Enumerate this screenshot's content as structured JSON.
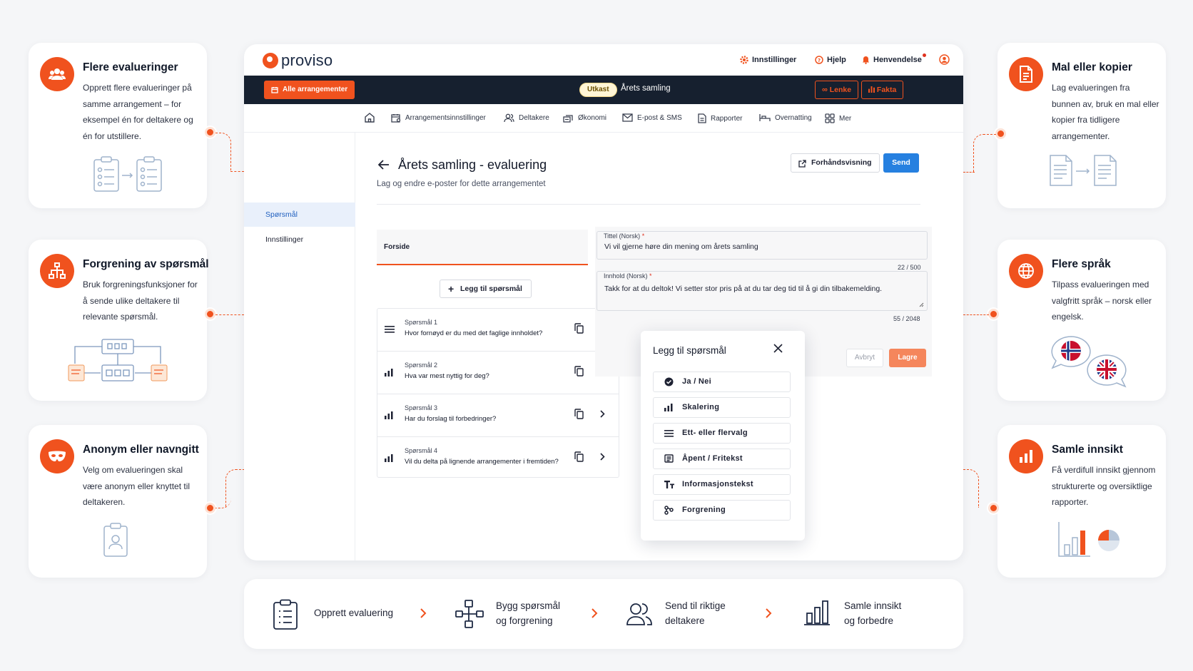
{
  "brand": {
    "name": "proviso",
    "accent": "#f0521e",
    "primary": "#2680e0",
    "dark": "#16202f"
  },
  "topnav": {
    "settings": "Innstillinger",
    "help": "Hjelp",
    "requests": "Henvendelse"
  },
  "darkbar": {
    "all_events": "Alle arrangementer",
    "status": "Utkast",
    "event_name": "Årets samling",
    "link": "Lenke",
    "facts": "Fakta"
  },
  "modules": [
    "Arrangementsinnstillinger",
    "Deltakere",
    "Økonomi",
    "E-post & SMS",
    "Rapporter",
    "Overnatting",
    "Mer"
  ],
  "sidebar": {
    "items": [
      {
        "label": "Spørsmål"
      },
      {
        "label": "Innstillinger"
      }
    ]
  },
  "page": {
    "title": "Årets samling - evaluering",
    "subtitle": "Lag og endre e-poster for dette arrangementet",
    "preview": "Forhåndsvisning",
    "send": "Send"
  },
  "tab": "Forside",
  "add_question": "Legg til spørsmål",
  "questions": [
    {
      "num": "Spørsmål 1",
      "text": "Hvor fornøyd er du med det faglige innholdet?",
      "icon": "list-lines-icon"
    },
    {
      "num": "Spørsmål 2",
      "text": "Hva var mest nyttig for deg?",
      "icon": "bar-chart-icon"
    },
    {
      "num": "Spørsmål 3",
      "text": "Har du forslag til forbedringer?",
      "icon": "bar-chart-icon"
    },
    {
      "num": "Spørsmål 4",
      "text": "Vil du delta på lignende arrangementer i fremtiden?",
      "icon": "bar-chart-icon"
    }
  ],
  "form": {
    "title_label": "Tittel (Norsk)",
    "title_value": "Vi vil gjerne høre din mening om årets samling",
    "title_count": "22 / 500",
    "content_label": "Innhold (Norsk)",
    "content_value": "Takk for at du deltok! Vi setter stor pris på at du tar deg tid til å gi din tilbakemelding.",
    "content_count": "55 / 2048",
    "required": "*",
    "cancel": "Avbryt",
    "save": "Lagre"
  },
  "popup": {
    "title": "Legg til spørsmål",
    "options": [
      {
        "label": "Ja / Nei",
        "icon": "check-circle-icon"
      },
      {
        "label": "Skalering",
        "icon": "bar-chart-icon"
      },
      {
        "label": "Ett- eller flervalg",
        "icon": "list-lines-icon"
      },
      {
        "label": "Åpent / Fritekst",
        "icon": "text-box-icon"
      },
      {
        "label": "Informasjonstekst",
        "icon": "text-format-icon"
      },
      {
        "label": "Forgrening",
        "icon": "branch-icon"
      }
    ]
  },
  "features_left": [
    {
      "title": "Flere evalueringer",
      "desc": "Opprett flere evalueringer på samme arrangement – for eksempel én for deltakere og én for utstillere."
    },
    {
      "title": "Forgrening av spørsmål",
      "desc": "Bruk forgreningsfunksjoner for å sende ulike deltakere til relevante spørsmål."
    },
    {
      "title": "Anonym eller navngitt",
      "desc": "Velg om evalueringen skal være anonym eller knyttet til deltakeren."
    }
  ],
  "features_right": [
    {
      "title": "Mal eller kopier",
      "desc": "Lag evalueringen fra bunnen av, bruk en mal eller kopier fra tidligere arrangementer."
    },
    {
      "title": "Flere språk",
      "desc": "Tilpass evalueringen med valgfritt språk – norsk eller engelsk."
    },
    {
      "title": "Samle innsikt",
      "desc": "Få verdifull innsikt gjennom strukturerte og oversiktlige rapporter."
    }
  ],
  "steps": [
    {
      "line1": "Opprett evaluering",
      "line2": ""
    },
    {
      "line1": "Bygg spørsmål",
      "line2": "og forgrening"
    },
    {
      "line1": "Send til riktige",
      "line2": "deltakere"
    },
    {
      "line1": "Samle innsikt",
      "line2": "og forbedre"
    }
  ]
}
